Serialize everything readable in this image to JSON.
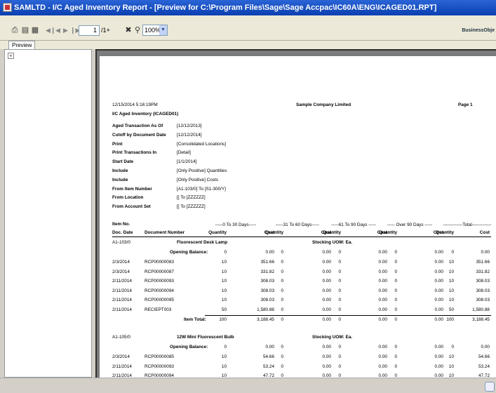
{
  "window": {
    "title": "SAMLTD - I/C Aged Inventory Report - [Preview for C:\\Program Files\\Sage\\Sage Accpac\\IC60A\\ENG\\ICAGED01.RPT]"
  },
  "toolbar": {
    "page_number": "1",
    "page_total": "/1+",
    "zoom": "100%",
    "logo": "BusinessObje"
  },
  "tabs": [
    {
      "label": "Preview"
    }
  ],
  "report": {
    "date_time": "12/15/2014  5:16:19PM",
    "company": "Sample Company Limited",
    "page": "Page 1",
    "title": "I/C Aged Inventory (ICAGED01)",
    "params": [
      {
        "label": "Aged Transaction As Of",
        "value": "[12/12/2013]"
      },
      {
        "label": "Cutoff by Document Date",
        "value": "[12/12/2014]"
      },
      {
        "label": "Print",
        "value": "[Consolidated Locations]"
      },
      {
        "label": "Print Transactions In",
        "value": "[Detail]"
      },
      {
        "label": "Start Date",
        "value": "[1/1/2014]"
      },
      {
        "label": "Include",
        "value": "[Only Positive] Quantities"
      },
      {
        "label": "Include",
        "value": "[Only Positive] Costs"
      },
      {
        "label": "From Item Number",
        "value": "[A1-103/0]  To  [S1-300/Y]"
      },
      {
        "label": "From Location",
        "value": "[]  To  [ZZZZZZ]"
      },
      {
        "label": "From Account Set",
        "value": "[]  To  [ZZZZZZ]"
      }
    ],
    "headers": {
      "item_no": "Item No.",
      "doc_date": "Doc. Date",
      "doc_number": "Document Number",
      "bucket1": "-----0 To 30 Days-----",
      "bucket2": "-----31 To 60 Days-----",
      "bucket3": "-----61 To 90 Days -----",
      "bucket4": "----- Over 90 Days -----",
      "bucket5": "-------------Total-------------",
      "quantity": "Quantity",
      "cost": "Cost"
    },
    "items": [
      {
        "code": "A1-103/0",
        "description": "Fluorescent Desk Lamp",
        "uom": "Stocking UOM:  Ea.",
        "opening": {
          "label": "Opening Balance:",
          "cells": [
            "0",
            "0.00",
            "0",
            "0.00",
            "0",
            "0.00",
            "0",
            "0.00",
            "0",
            "0.00"
          ]
        },
        "rows": [
          {
            "date": "2/3/2014",
            "doc": "RCP00000083",
            "cells": [
              "10",
              "351.66",
              "0",
              "0.00",
              "0",
              "0.00",
              "0",
              "0.00",
              "10",
              "351.66"
            ]
          },
          {
            "date": "2/3/2014",
            "doc": "RCP00000087",
            "cells": [
              "10",
              "331.82",
              "0",
              "0.00",
              "0",
              "0.00",
              "0",
              "0.00",
              "10",
              "331.82"
            ]
          },
          {
            "date": "2/11/2014",
            "doc": "RCP00000093",
            "cells": [
              "10",
              "308.03",
              "0",
              "0.00",
              "0",
              "0.00",
              "0",
              "0.00",
              "10",
              "308.03"
            ]
          },
          {
            "date": "2/11/2014",
            "doc": "RCP00000094",
            "cells": [
              "10",
              "308.03",
              "0",
              "0.00",
              "0",
              "0.00",
              "0",
              "0.00",
              "10",
              "308.03"
            ]
          },
          {
            "date": "2/11/2014",
            "doc": "RCP00000095",
            "cells": [
              "10",
              "308.03",
              "0",
              "0.00",
              "0",
              "0.00",
              "0",
              "0.00",
              "10",
              "308.03"
            ]
          },
          {
            "date": "2/11/2014",
            "doc": "RECIEPT003",
            "cells": [
              "50",
              "1,580.88",
              "0",
              "0.00",
              "0",
              "0.00",
              "0",
              "0.00",
              "50",
              "1,580.88"
            ]
          }
        ],
        "total": {
          "label": "Item Total:",
          "cells": [
            "100",
            "3,188.45",
            "0",
            "0.00",
            "0",
            "0.00",
            "0",
            "0.00",
            "100",
            "3,188.45"
          ]
        }
      },
      {
        "code": "A1-105/0",
        "description": "12W Mini Fluorescent Bulb",
        "uom": "Stocking UOM:  Ea.",
        "opening": {
          "label": "Opening Balance:",
          "cells": [
            "0",
            "0.00",
            "0",
            "0.00",
            "0",
            "0.00",
            "0",
            "0.00",
            "0",
            "0.00"
          ]
        },
        "rows": [
          {
            "date": "2/3/2014",
            "doc": "RCP00000085",
            "cells": [
              "10",
              "54.66",
              "0",
              "0.00",
              "0",
              "0.00",
              "0",
              "0.00",
              "10",
              "54.66"
            ]
          },
          {
            "date": "2/11/2014",
            "doc": "RCP00000093",
            "cells": [
              "10",
              "53.24",
              "0",
              "0.00",
              "0",
              "0.00",
              "0",
              "0.00",
              "10",
              "53.24"
            ]
          },
          {
            "date": "2/11/2014",
            "doc": "RCP00000094",
            "cells": [
              "10",
              "47.72",
              "0",
              "0.00",
              "0",
              "0.00",
              "0",
              "0.00",
              "10",
              "47.72"
            ]
          }
        ]
      }
    ]
  }
}
